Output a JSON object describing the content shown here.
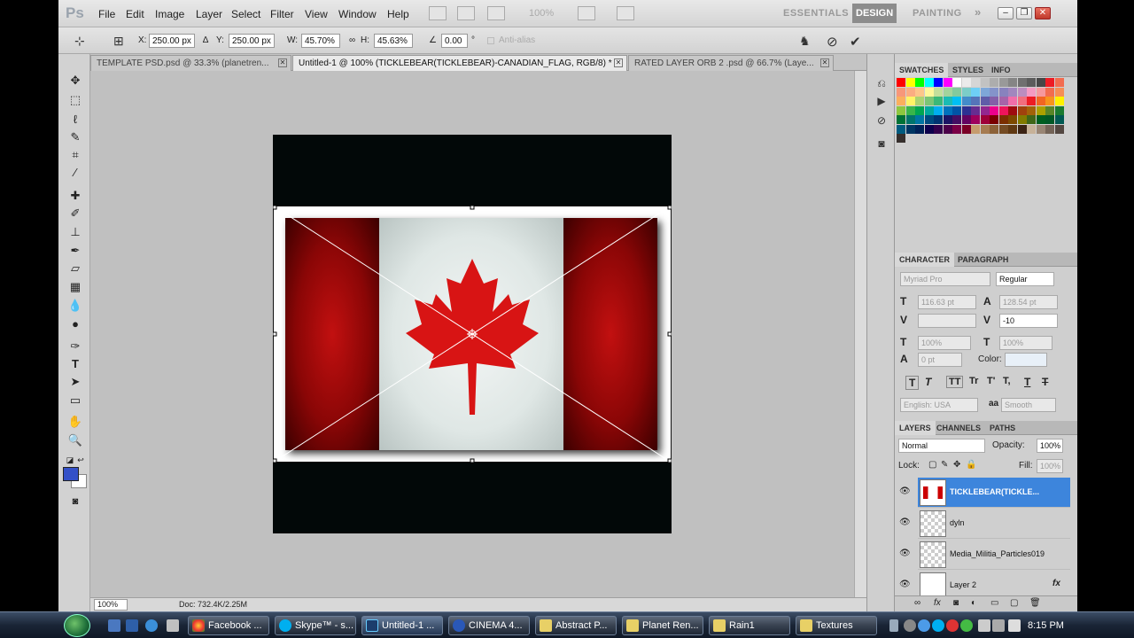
{
  "app": {
    "logo": "Ps"
  },
  "menu": [
    "File",
    "Edit",
    "Image",
    "Layer",
    "Select",
    "Filter",
    "View",
    "Window",
    "Help"
  ],
  "menubar": {
    "zoom": "100%"
  },
  "workspaces": {
    "essentials": "ESSENTIALS",
    "design": "DESIGN",
    "painting": "PAINTING",
    "more": "»"
  },
  "window_buttons": {
    "minimize": "–",
    "restore": "❐",
    "close": "✕"
  },
  "options": {
    "x_label": "X:",
    "x_value": "250.00 px",
    "y_label": "Y:",
    "y_value": "250.00 px",
    "w_label": "W:",
    "w_value": "45.70%",
    "h_label": "H:",
    "h_value": "45.63%",
    "angle_value": "0.00",
    "angle_unit": "°",
    "antialias": "Anti-alias"
  },
  "tabs": [
    {
      "label": "TEMPLATE PSD.psd @ 33.3% (planetren..."
    },
    {
      "label": "Untitled-1 @ 100% (TICKLEBEAR(TICKLEBEAR)-CANADIAN_FLAG, RGB/8) *"
    },
    {
      "label": "RATED LAYER ORB 2 .psd @ 66.7% (Laye..."
    }
  ],
  "status": {
    "zoom": "100%",
    "doc": "Doc: 732.4K/2.25M"
  },
  "swatches": {
    "tabs": [
      "SWATCHES",
      "STYLES",
      "INFO"
    ],
    "colors": [
      "#ff0000",
      "#ffff00",
      "#00ff00",
      "#00ffff",
      "#0000ff",
      "#ff00ff",
      "#ffffff",
      "#ebebeb",
      "#d6d6d6",
      "#c2c2c2",
      "#adadad",
      "#999999",
      "#858585",
      "#707070",
      "#5c5c5c",
      "#474747",
      "#ed1c24",
      "#f26c4f",
      "#f7977a",
      "#fbad82",
      "#fdc68a",
      "#fff79a",
      "#c4df9b",
      "#a3d39c",
      "#82ca9d",
      "#7bcdc8",
      "#6ecff6",
      "#7ea7d8",
      "#8493ca",
      "#8882be",
      "#a187be",
      "#bc8dbf",
      "#f49ac2",
      "#f6989d",
      "#f26c4f",
      "#f68e55",
      "#fbaf5d",
      "#fff467",
      "#acd372",
      "#7cc576",
      "#3bb878",
      "#1abbb4",
      "#00bff3",
      "#438cca",
      "#5574b9",
      "#605ca8",
      "#855fa8",
      "#a763a8",
      "#f06ea9",
      "#f26d7d",
      "#ed1c24",
      "#f26522",
      "#f7941d",
      "#fff200",
      "#8dc73f",
      "#39b54a",
      "#00a651",
      "#00a99d",
      "#00aeef",
      "#0072bc",
      "#0054a6",
      "#2e3192",
      "#662d91",
      "#92278f",
      "#ec008c",
      "#ed145b",
      "#9e0b0f",
      "#a0410d",
      "#a36209",
      "#aba000",
      "#598527",
      "#1a7b30",
      "#007236",
      "#00746b",
      "#0076a3",
      "#004b80",
      "#003471",
      "#1b1464",
      "#440e62",
      "#630460",
      "#9e005d",
      "#9e0039",
      "#790000",
      "#7b2e00",
      "#7d4900",
      "#827b00",
      "#406618",
      "#005e20",
      "#005826",
      "#005952",
      "#005b7f",
      "#003663",
      "#002157",
      "#0d004c",
      "#32004b",
      "#4b0049",
      "#7b0046",
      "#7a0026",
      "#c69c6e",
      "#a67c52",
      "#8c6239",
      "#754c24",
      "#603913",
      "#3c2415",
      "#c7b299",
      "#998675",
      "#736357",
      "#534741",
      "#362f2d"
    ]
  },
  "character": {
    "tabs": [
      "CHARACTER",
      "PARAGRAPH"
    ],
    "font": "Myriad Pro",
    "style": "Regular",
    "size": "116.63 pt",
    "leading": "128.54 pt",
    "tracking": "-10",
    "vscale": "100%",
    "hscale": "100%",
    "baseline": "0 pt",
    "color_label": "Color:",
    "language": "English: USA",
    "aa_label": "aa",
    "aa": "Smooth",
    "style_buttons": [
      "T",
      "T",
      "TT",
      "Tr",
      "T'",
      "T,",
      "T",
      "T"
    ]
  },
  "layers": {
    "tabs": [
      "LAYERS",
      "CHANNELS",
      "PATHS"
    ],
    "blend": "Normal",
    "opacity_label": "Opacity:",
    "opacity": "100%",
    "lock_label": "Lock:",
    "fill_label": "Fill:",
    "fill": "100%",
    "items": [
      {
        "name": "TICKLEBEAR(TICKLE..."
      },
      {
        "name": "dyln"
      },
      {
        "name": "Media_Militia_Particles019"
      },
      {
        "name": "Layer 2"
      }
    ],
    "fx": "fx"
  },
  "taskbar": {
    "items": [
      {
        "label": "Facebook ..."
      },
      {
        "label": "Skype™ - s..."
      },
      {
        "label": "Untitled-1 ..."
      },
      {
        "label": "CINEMA 4..."
      },
      {
        "label": "Abstract P..."
      },
      {
        "label": "Planet Ren..."
      },
      {
        "label": "Rain1"
      },
      {
        "label": "Textures"
      }
    ],
    "clock": "8:15 PM"
  }
}
